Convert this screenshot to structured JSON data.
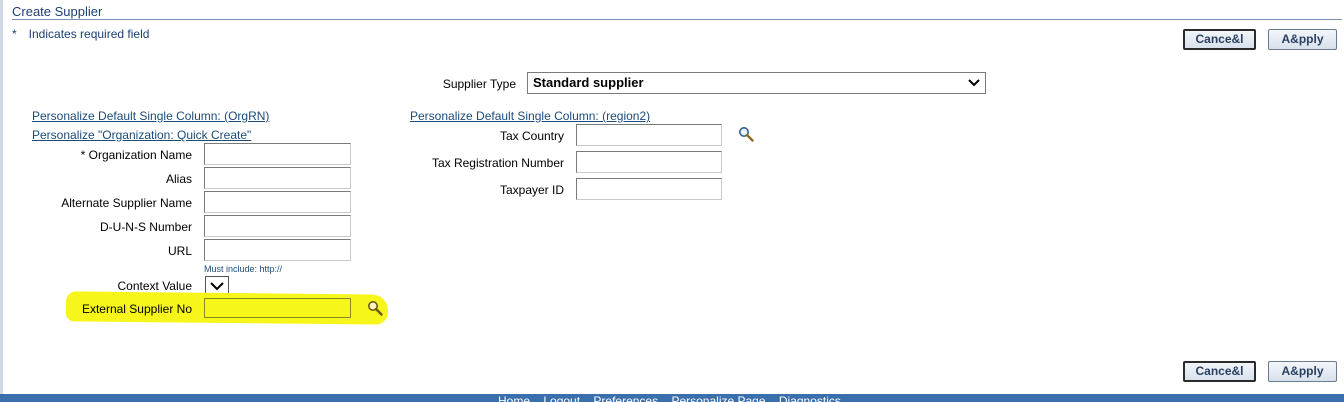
{
  "page": {
    "title": "Create Supplier",
    "required_marker": "*",
    "required_note": "Indicates required field"
  },
  "buttons": {
    "cancel": "Cance&l",
    "apply": "A&pply"
  },
  "supplier_type": {
    "label": "Supplier Type",
    "selected": "Standard supplier"
  },
  "left_region": {
    "personalize_link_1": "Personalize Default Single Column: (OrgRN)",
    "personalize_link_2": "Personalize \"Organization: Quick Create\"",
    "org_name_marker": "*",
    "fields": {
      "organization_name": {
        "label": "Organization Name",
        "value": ""
      },
      "alias": {
        "label": "Alias",
        "value": ""
      },
      "alternate_supplier_name": {
        "label": "Alternate Supplier Name",
        "value": ""
      },
      "duns_number": {
        "label": "D-U-N-S Number",
        "value": ""
      },
      "url": {
        "label": "URL",
        "value": "",
        "hint": "Must include: http://"
      },
      "context_value": {
        "label": "Context Value"
      },
      "external_supplier_no": {
        "label": "External Supplier No",
        "value": ""
      }
    }
  },
  "right_region": {
    "personalize_link": "Personalize Default Single Column: (region2)",
    "fields": {
      "tax_country": {
        "label": "Tax Country",
        "value": ""
      },
      "tax_registration_number": {
        "label": "Tax Registration Number",
        "value": ""
      },
      "taxpayer_id": {
        "label": "Taxpayer ID",
        "value": ""
      }
    }
  },
  "footer": {
    "links": [
      "Home",
      "Logout",
      "Preferences",
      "Personalize Page",
      "Diagnostics"
    ],
    "color": "#3a6fae"
  },
  "colors": {
    "title": "#1c3f73",
    "highlight": "#f7f61a"
  },
  "icons": {
    "lov": "magnifier-icon",
    "dropdown": "chevron-down-icon"
  }
}
